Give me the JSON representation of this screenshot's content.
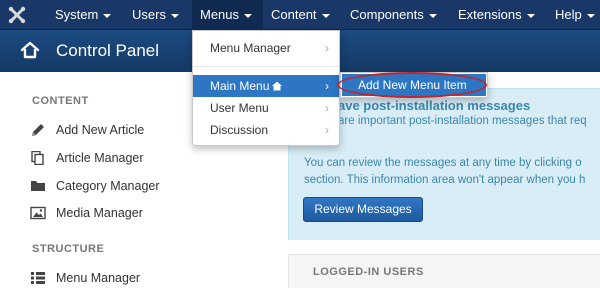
{
  "topnav": {
    "logo_icon": "joomla-logo-icon",
    "items": [
      {
        "label": "System"
      },
      {
        "label": "Users"
      },
      {
        "label": "Menus"
      },
      {
        "label": "Content"
      },
      {
        "label": "Components"
      },
      {
        "label": "Extensions"
      },
      {
        "label": "Help"
      }
    ]
  },
  "header": {
    "title": "Control Panel",
    "icon": "home-icon"
  },
  "sidebar": {
    "content_title": "CONTENT",
    "content_items": [
      {
        "label": "Add New Article",
        "icon": "pencil-icon"
      },
      {
        "label": "Article Manager",
        "icon": "copy-icon"
      },
      {
        "label": "Category Manager",
        "icon": "folder-icon"
      },
      {
        "label": "Media Manager",
        "icon": "image-icon"
      }
    ],
    "structure_title": "STRUCTURE",
    "structure_items": [
      {
        "label": "Menu Manager",
        "icon": "list-icon"
      }
    ]
  },
  "messages": {
    "title": "ave post-installation messages",
    "subtitle": "are important post-installation messages that req",
    "body_line1": "You can review the messages at any time by clicking o",
    "body_line2": "section. This information area won't appear when you h",
    "button_label": "Review Messages"
  },
  "logged_in": {
    "title": "LOGGED-IN USERS"
  },
  "menus_dropdown": {
    "items": [
      {
        "label": "Menu Manager"
      },
      {
        "label": "Main Menu"
      },
      {
        "label": "User Menu"
      },
      {
        "label": "Discussion"
      }
    ],
    "submenu_item": "Add New Menu Item"
  },
  "colors": {
    "navbar": "#1a3867",
    "header": "#17406f",
    "highlight": "#2d76c4",
    "annotation_oval": "#c0252b"
  }
}
